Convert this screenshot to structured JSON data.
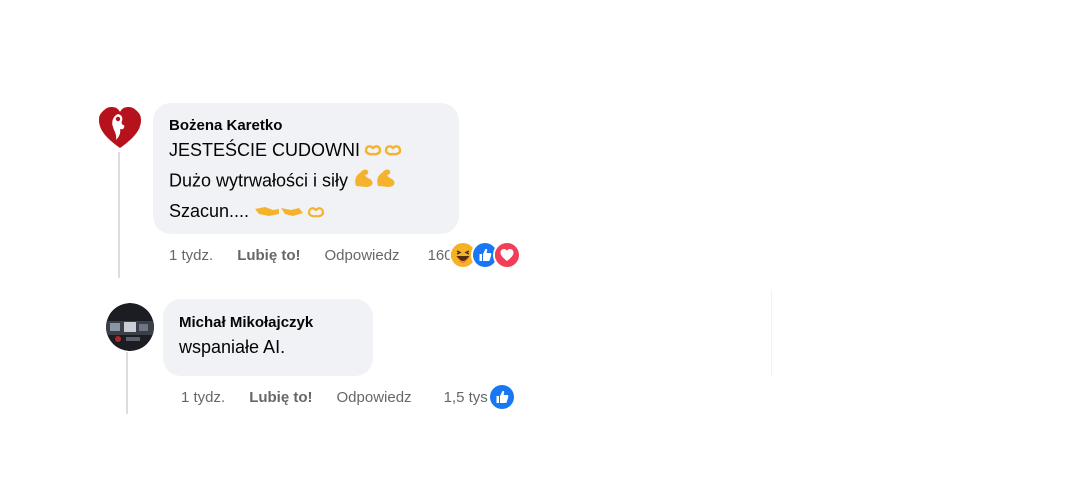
{
  "comments": [
    {
      "author": "Bożena Karetko",
      "lines": [
        "JESTEŚCIE CUDOWNI",
        "Dużo wytrwałości i siły",
        "Szacun...."
      ],
      "line_emojis": [
        [
          "heart-hands-emoji",
          "heart-hands-emoji"
        ],
        [
          "flexed-biceps-emoji",
          "flexed-biceps-emoji"
        ],
        [
          "handshake-emoji",
          "heart-hands-emoji"
        ]
      ],
      "time": "1 tydz.",
      "like_label": "Lubię to!",
      "reply_label": "Odpowiedz",
      "reaction_count": "160",
      "reactions": [
        "haha-icon",
        "like-icon",
        "love-icon"
      ]
    },
    {
      "author": "Michał Mikołajczyk",
      "lines": [
        "wspaniałe AI."
      ],
      "time": "1 tydz.",
      "like_label": "Lubię to!",
      "reply_label": "Odpowiedz",
      "reaction_count": "1,5 tys.",
      "reactions": [
        "like-icon"
      ]
    }
  ],
  "colors": {
    "bubble": "#f0f2f5",
    "meta_text": "#65676b",
    "like_blue": "#1877f2",
    "love_red": "#f33e58",
    "haha_yellow": "#f7b125",
    "thread_line": "#dadde1"
  }
}
